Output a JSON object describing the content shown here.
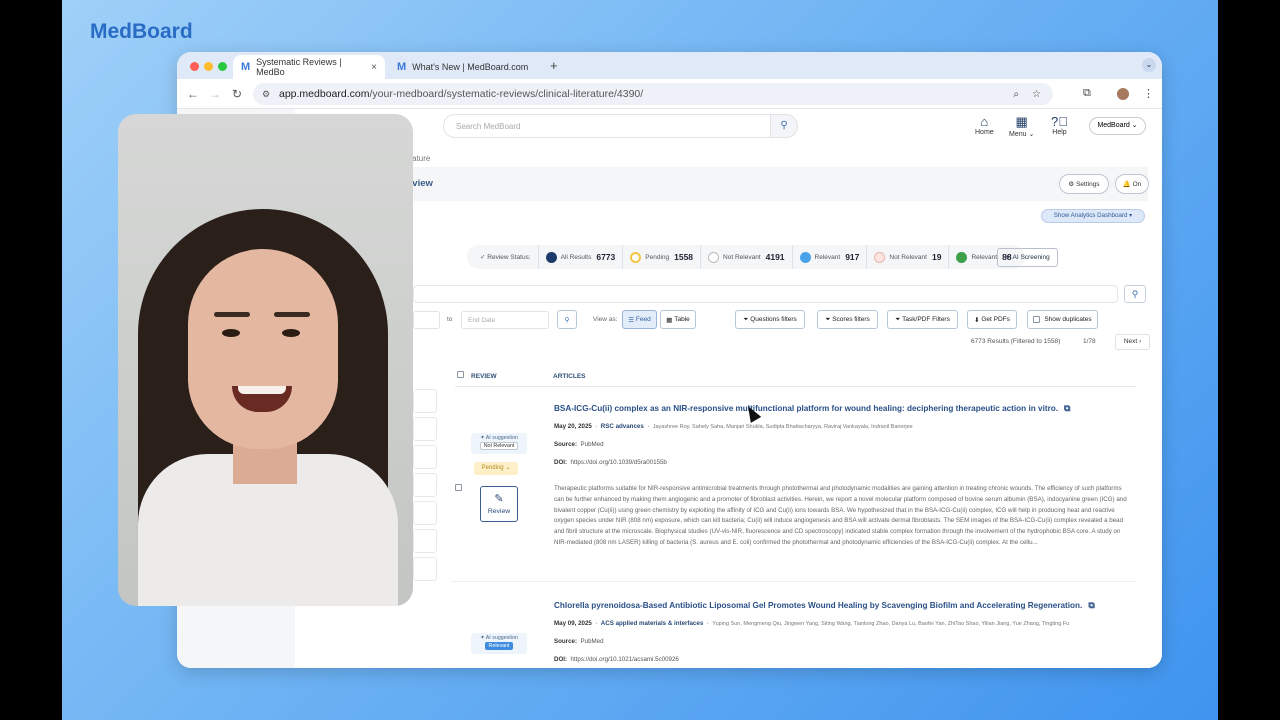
{
  "brand": "MedBoard",
  "browser": {
    "tabs": [
      {
        "label": "Systematic Reviews | MedBo",
        "close": "×"
      },
      {
        "label": "What's New | MedBoard.com"
      }
    ],
    "new_tab": "+",
    "url_host": "app.medboard.com",
    "url_path": "/your-medboard/systematic-reviews/clinical-literature/4390/"
  },
  "header": {
    "search_placeholder": "Search MedBoard",
    "nav": [
      {
        "label": "Home"
      },
      {
        "label": "Menu"
      },
      {
        "label": "Help"
      }
    ],
    "account": "MedBoard"
  },
  "page": {
    "breadcrumb": "iterature",
    "title": "eview",
    "settings": "Settings",
    "bell_on": "On",
    "analytics": "Show Analytics Dashboard ▾"
  },
  "status": {
    "label": "Review Status:",
    "items": [
      {
        "label": "All Results",
        "count": "6773",
        "color": "#1d3a6b"
      },
      {
        "label": "Pending",
        "count": "1558",
        "color": "#f4c542"
      },
      {
        "label": "Not Relevant",
        "count": "4191",
        "color": "#ffffff"
      },
      {
        "label": "Relevant",
        "count": "917",
        "color": "#4aa3e8"
      },
      {
        "label": "Not Relevant",
        "count": "19",
        "color": "#fde4e0"
      },
      {
        "label": "Relevant",
        "count": "88",
        "color": "#3fa04b"
      }
    ],
    "ai_screening": "AI Screening"
  },
  "filters": {
    "to": "to",
    "end_date": "End Date",
    "view_as": "View as:",
    "feed": "Feed",
    "table": "Table",
    "questions": "Questions filters",
    "scores": "Scores filters",
    "task_pdf": "Task/PDF Filters",
    "get_pdfs": "Get PDFs",
    "show_duplicates": "Show duplicates"
  },
  "pagination": {
    "results": "6773 Results (Filtered to 1558)",
    "page": "1/78",
    "next": "Next"
  },
  "table": {
    "col_review": "REVIEW",
    "col_articles": "ARTICLES"
  },
  "articles": [
    {
      "title": "BSA-ICG-Cu(ii) complex as an NIR-responsive multifunctional platform for wound healing: deciphering therapeutic action in vitro.",
      "date": "May 20, 2025",
      "journal": "RSC advances",
      "authors": "Jayashree Roy, Sahely Saha, Manjari Shukla, Sudipta Bhattacharyya, Raviraj Vankayala, Indranil Banerjee",
      "source_label": "Source:",
      "source": "PubMed",
      "doi_label": "DOI:",
      "doi": "https://doi.org/10.1039/d5ra00155b",
      "ai_label": "AI suggestion",
      "ai_tag": "Not Relevant",
      "status": "Pending",
      "review": "Review",
      "abstract": "Therapeutic platforms suitable for NIR-responsive antimicrobial treatments through photothermal and photodynamic modalities are gaining attention in treating chronic wounds. The efficiency of such platforms can be further enhanced by making them angiogenic and a promoter of fibroblast activities. Herein, we report a novel molecular platform composed of bovine serum albumin (BSA), indocyanine green (ICG) and bivalent copper (Cu(ii)) using green chemistry by exploiting the affinity of ICG and Cu(ii) ions towards BSA. We hypothesized that in the BSA-ICG-Cu(ii) complex, ICG will help in producing heat and reactive oxygen species under NIR (808 nm) exposure, which can kill bacteria; Cu(ii) will induce angiogenesis and BSA will activate dermal fibroblasts. The SEM images of the BSA-ICG-Cu(ii) complex revealed a bead and fibril structure at the microscale. Biophysical studies (UV-vis-NIR, fluorescence and CD spectroscopy) indicated stable complex formation through the involvement of the hydrophobic BSA core. A study on NIR-mediated (808 nm LASER) killing of bacteria (S. aureus and E. coli) confirmed the photothermal and photodynamic efficiencies of the BSA-ICG-Cu(ii) complex. At the cellu..."
    },
    {
      "title": "Chlorella pyrenoidosa-Based Antibiotic Liposomal Gel Promotes Wound Healing by Scavenging Biofilm and Accelerating Regeneration.",
      "date": "May 09, 2025",
      "journal": "ACS applied materials & interfaces",
      "authors": "Yuping Sun, Mengmeng Qiu, Jingwen Yang, Siting Wang, Tianlong Zhao, Danya Lu, Baofei Yan, ZhiTao Shao, Yilian Jiang, Yue Zhang, Tingting Fu",
      "source_label": "Source:",
      "source": "PubMed",
      "doi_label": "DOI:",
      "doi": "https://doi.org/10.1021/acsami.5c00926",
      "ai_label": "AI suggestion",
      "ai_tag": "Relevant"
    }
  ],
  "colors": {
    "accent": "#2a5087",
    "brand": "#2a6cc4",
    "background": "#4a9cf0"
  }
}
